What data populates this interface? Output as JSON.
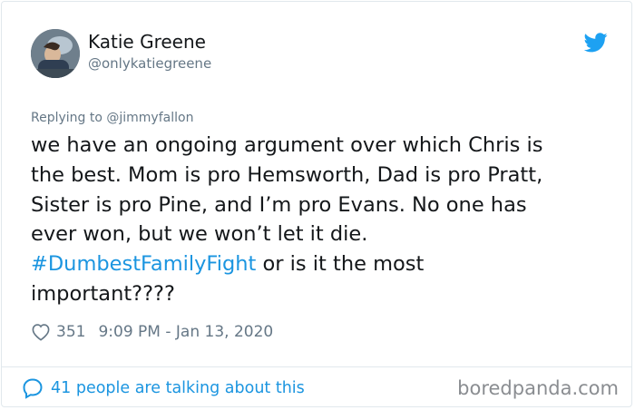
{
  "tweet": {
    "author": {
      "display_name": "Katie Greene",
      "handle": "@onlykatiegreene"
    },
    "replying_to": "Replying to @jimmyfallon",
    "text_lines": [
      "we have an ongoing argument over which Chris is",
      "the best. Mom is pro Hemsworth, Dad is pro Pratt,",
      "Sister is pro Pine, and I’m pro Evans. No one has",
      "ever won, but we won’t let it die."
    ],
    "hashtag": "#DumbestFamilyFight",
    "text_after_hashtag": " or is it the most",
    "text_last_line": "important????",
    "likes": "351",
    "timestamp": "9:09 PM - Jan 13, 2020",
    "talking": "41 people are talking about this"
  },
  "watermark": "boredpanda.com",
  "icons": {
    "brand": "twitter-bird-icon",
    "like": "heart-icon",
    "reply": "speech-bubble-icon"
  },
  "colors": {
    "link": "#1b95e0",
    "secondary": "#657786",
    "text": "#14171a",
    "border": "#e1e8ed"
  }
}
